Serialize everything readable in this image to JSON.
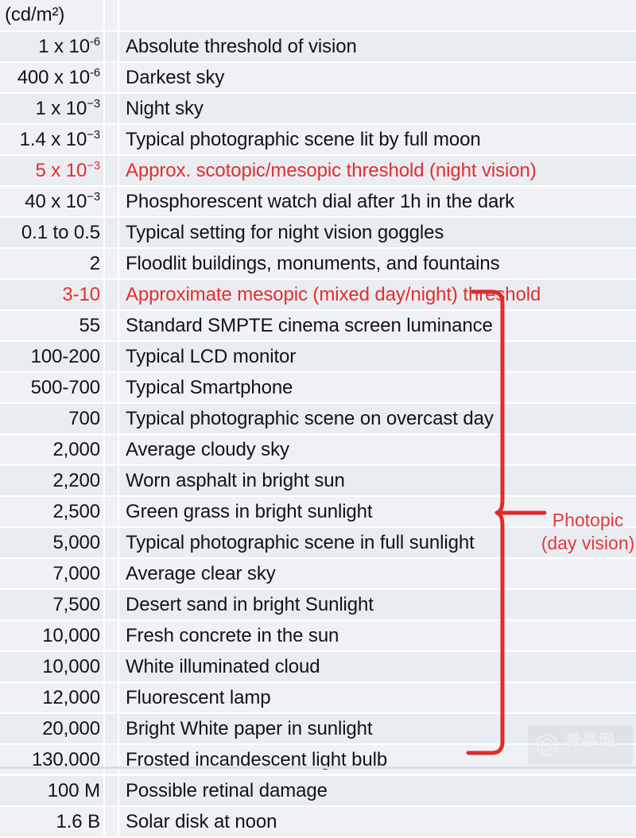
{
  "table": {
    "header": {
      "unit_label": "(cd/m²)",
      "description_label": ""
    },
    "rows": [
      {
        "value": "1 x 10",
        "exp": "-6",
        "desc": "Absolute threshold of vision",
        "red": false
      },
      {
        "value": "400 x 10",
        "exp": "-6",
        "desc": "Darkest sky",
        "red": false
      },
      {
        "value": "1 x 10",
        "exp": "−3",
        "desc": "Night sky",
        "red": false
      },
      {
        "value": "1.4 x 10",
        "exp": "−3",
        "desc": "Typical photographic scene lit by full moon",
        "red": false
      },
      {
        "value": "5 x 10",
        "exp": "−3",
        "desc": "Approx. scotopic/mesopic threshold (night vision)",
        "red": true
      },
      {
        "value": "40 x 10",
        "exp": "−3",
        "desc": "Phosphorescent watch dial after 1h in the dark",
        "red": false
      },
      {
        "value": "0.1 to 0.5",
        "exp": "",
        "desc": "Typical setting for night vision goggles",
        "red": false
      },
      {
        "value": "2",
        "exp": "",
        "desc": "Floodlit buildings, monuments, and fountains",
        "red": false
      },
      {
        "value": "3-10",
        "exp": "",
        "desc": "Approximate mesopic (mixed day/night) threshold",
        "red": true
      },
      {
        "value": "55",
        "exp": "",
        "desc": "Standard SMPTE cinema screen luminance",
        "red": false
      },
      {
        "value": "100-200",
        "exp": "",
        "desc": "Typical LCD monitor",
        "red": false
      },
      {
        "value": "500-700",
        "exp": "",
        "desc": "Typical Smartphone",
        "red": false
      },
      {
        "value": "700",
        "exp": "",
        "desc": "Typical photographic scene on overcast day",
        "red": false
      },
      {
        "value": "2,000",
        "exp": "",
        "desc": "Average cloudy sky",
        "red": false
      },
      {
        "value": "2,200",
        "exp": "",
        "desc": "Worn asphalt in bright sun",
        "red": false
      },
      {
        "value": "2,500",
        "exp": "",
        "desc": "Green grass in bright sunlight",
        "red": false
      },
      {
        "value": "5,000",
        "exp": "",
        "desc": "Typical photographic scene in full sunlight",
        "red": false
      },
      {
        "value": "7,000",
        "exp": "",
        "desc": "Average clear sky",
        "red": false
      },
      {
        "value": "7,500",
        "exp": "",
        "desc": "Desert sand in bright Sunlight",
        "red": false
      },
      {
        "value": "10,000",
        "exp": "",
        "desc": "Fresh concrete in the sun",
        "red": false
      },
      {
        "value": "10,000",
        "exp": "",
        "desc": "White illuminated cloud",
        "red": false
      },
      {
        "value": "12,000",
        "exp": "",
        "desc": "Fluorescent lamp",
        "red": false
      },
      {
        "value": "20,000",
        "exp": "",
        "desc": "Bright White paper in sunlight",
        "red": false
      },
      {
        "value": "130,000",
        "exp": "",
        "desc": "Frosted incandescent light bulb",
        "red": false
      },
      {
        "value": "100 M",
        "exp": "",
        "desc": "Possible retinal damage",
        "red": false
      },
      {
        "value": "1.6 B",
        "exp": "",
        "desc": "Solar disk at noon",
        "red": false
      }
    ]
  },
  "annotation": {
    "bracket_label_line1": "Photopic",
    "bracket_label_line2": "(day vision)",
    "bracket_color": "#e03a3a"
  },
  "watermark": {
    "text_cn": "青亭网",
    "url": "www.7tin.cn"
  },
  "colors": {
    "row_background": "#e9ecf1",
    "row_background_alt": "#eff1f5",
    "gridline": "#ffffff",
    "text": "#111315",
    "red_text": "#e03030",
    "bottom_rule": "#cfe0ea"
  }
}
